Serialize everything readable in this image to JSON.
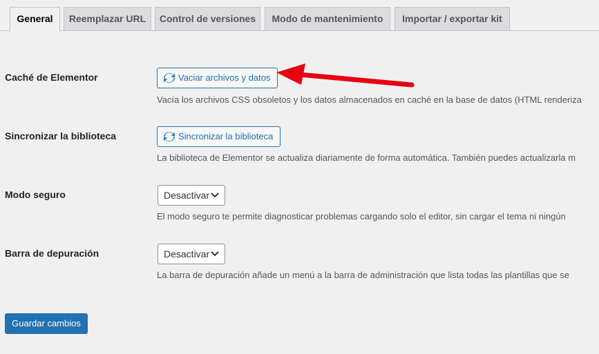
{
  "tabs": [
    {
      "label": "General",
      "active": true
    },
    {
      "label": "Reemplazar URL",
      "active": false
    },
    {
      "label": "Control de versiones",
      "active": false
    },
    {
      "label": "Modo de mantenimiento",
      "active": false
    },
    {
      "label": "Importar / exportar kit",
      "active": false
    }
  ],
  "settings": {
    "cache": {
      "label": "Caché de Elementor",
      "button": "Vaciar archivos y datos",
      "description": "Vacía los archivos CSS obsoletos y los datos almacenados en caché en la base de datos (HTML renderiza"
    },
    "sync": {
      "label": "Sincronizar la biblioteca",
      "button": "Sincronizar la biblioteca",
      "description": "La biblioteca de Elementor se actualiza diariamente de forma automática. También puedes actualizarla m"
    },
    "safe_mode": {
      "label": "Modo seguro",
      "selected": "Desactivar",
      "description": "El modo seguro te permite diagnosticar problemas cargando solo el editor, sin cargar el tema ni ningún"
    },
    "debug_bar": {
      "label": "Barra de depuración",
      "selected": "Desactivar",
      "description": "La barra de depuración añade un menú a la barra de administración que lista todas las plantillas que se"
    }
  },
  "save_button": "Guardar cambios",
  "icons": {
    "refresh": "refresh-icon",
    "chevron": "chevron-down-icon",
    "annotation": "red-arrow-annotation"
  },
  "colors": {
    "accent": "#2271b1",
    "background": "#f0f0f1",
    "annotation": "#e60012"
  }
}
